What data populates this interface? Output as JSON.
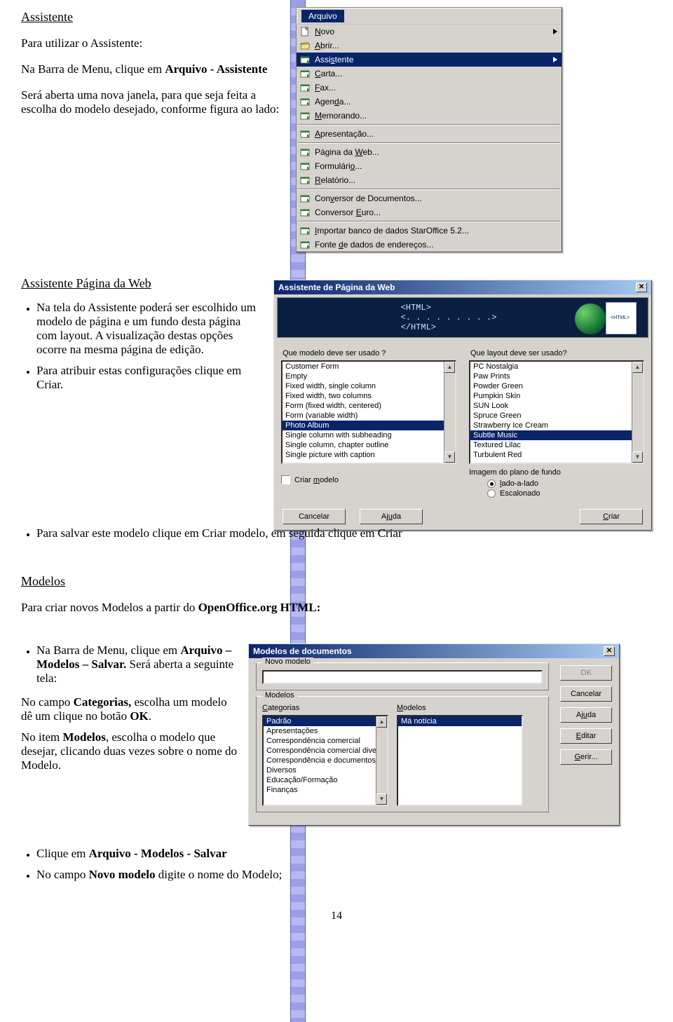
{
  "sec1": {
    "title": "Assistente",
    "p1a": "Para utilizar o Assistente:",
    "p1b_a": "Na Barra de Menu, clique em ",
    "p1b_b": "Arquivo - Assistente",
    "p1c": "Será aberta uma nova janela, para que seja feita a escolha do modelo desejado, conforme figura ao lado:"
  },
  "menu": {
    "title_label": "Arquivo",
    "items": [
      {
        "icon": "doc",
        "labelA": "N",
        "labelB": "ovo",
        "sub": true
      },
      {
        "icon": "open",
        "labelA": "A",
        "labelB": "brir..."
      },
      {
        "icon": "asst",
        "labelA": "Assi",
        "labelB": "s",
        "labelC": "tente",
        "sub": true,
        "selected": true,
        "under_mid": true
      },
      {
        "icon": "card",
        "labelA": "C",
        "labelB": "arta..."
      },
      {
        "icon": "card",
        "labelA": "F",
        "labelB": "ax..."
      },
      {
        "icon": "card",
        "labelA": "Agen",
        "labelB": "d",
        "labelC": "a...",
        "under_mid": true
      },
      {
        "icon": "card",
        "labelA": "M",
        "labelB": "emorando..."
      },
      {
        "divider": true
      },
      {
        "icon": "card",
        "labelA": "A",
        "labelB": "presentação..."
      },
      {
        "divider": true
      },
      {
        "icon": "card",
        "labelA": "Página da ",
        "labelB": "W",
        "labelC": "eb...",
        "under_mid": true
      },
      {
        "icon": "card",
        "labelA": "Formulári",
        "labelB": "o",
        "labelC": "...",
        "under_mid": true
      },
      {
        "icon": "card",
        "labelA": "R",
        "labelB": "elatório..."
      },
      {
        "divider": true
      },
      {
        "icon": "card",
        "labelA": "Con",
        "labelB": "v",
        "labelC": "ersor de Documentos...",
        "under_mid": true
      },
      {
        "icon": "card",
        "labelA": "Conversor ",
        "labelB": "E",
        "labelC": "uro...",
        "under_mid": true
      },
      {
        "divider": true
      },
      {
        "icon": "card",
        "labelA": "I",
        "labelB": "mportar banco de dados StarOffice 5.2..."
      },
      {
        "icon": "card",
        "labelA": "Fonte ",
        "labelB": "d",
        "labelC": "e dados de endereços...",
        "under_mid": true
      }
    ]
  },
  "sec2": {
    "title": "Assistente Página da Web",
    "b1": "Na tela do Assistente poderá ser escolhido um modelo de página e um fundo desta página com layout. A visualização destas opções ocorre na mesma página de edição.",
    "b2": " Para atribuir estas configurações clique em Criar.",
    "b3": "Para salvar este modelo clique em Criar modelo, em seguida clique em Criar"
  },
  "wizard": {
    "title": "Assistente de Página da Web",
    "banner": {
      "l1": "<HTML>",
      "l2": "<. . . . . . . . .>",
      "l3": "</HTML>"
    },
    "q1": "Que modelo deve ser usado ?",
    "q2": "Que layout deve ser usado?",
    "list1": [
      "Customer Form",
      "Empty",
      "Fixed width, single column",
      "Fixed width, two columns",
      "Form (fixed width, centered)",
      "Form (variable width)",
      "Photo Album",
      "Single column with subheading",
      "Single column, chapter outline",
      "Single picture with caption"
    ],
    "list1_selected": 6,
    "list2": [
      "PC Nostalgia",
      "Paw Prints",
      "Powder Green",
      "Pumpkin Skin",
      "SUN Look",
      "Spruce Green",
      "Strawberry Ice Cream",
      "Subtle Music",
      "Textured Lilac",
      "Turbulent Red"
    ],
    "list2_selected": 7,
    "check_label": "Criar modelo (underline m)",
    "check_txt_a": "Criar ",
    "check_txt_u": "m",
    "check_txt_b": "odelo",
    "bg_title": "Imagem do plano de fundo",
    "r1_a": "l",
    "r1_b": "ado-a-lado",
    "r2_b": "Escalonado",
    "btn_cancel": "Cancelar",
    "btn_help": "Ajuda",
    "btn_create": "Criar",
    "btn_create_u": "C",
    "btn_create_b": "riar"
  },
  "sec3": {
    "title": "Modelos",
    "p_a": "Para criar novos Modelos a partir do ",
    "p_b": "OpenOffice.org HTML:"
  },
  "sec3b": {
    "b1_a": "Na Barra de Menu, clique em ",
    "b1_b": "Arquivo – Modelos – Salvar.",
    "b1_c": " Será aberta a seguinte tela:",
    "p2_a": "No campo ",
    "p2_b": "Categorias,",
    "p2_c": " escolha um modelo dê um clique no botão ",
    "p2_d": "OK",
    "p2_e": ".",
    "p3_a": "No item ",
    "p3_b": "Modelos",
    "p3_c": ", escolha o modelo que desejar, clicando duas vezes sobre o nome do Modelo.",
    "b2_a": "Clique em ",
    "b2_b": "Arquivo - Modelos - Salvar",
    "b3_a": "No campo  ",
    "b3_b": "Novo modelo",
    "b3_c": " digite o nome do Modelo;"
  },
  "templates": {
    "title": "Modelos de documentos",
    "grp1": "Novo modelo",
    "grp2": "Modelos",
    "lbl_cat_u": "C",
    "lbl_cat_b": "ategorias",
    "lbl_mod_u": "M",
    "lbl_mod_b": "odelos",
    "cats": [
      "Padrão",
      "Apresentações",
      "Correspondência comercial",
      "Correspondência comercial diversa",
      "Correspondência e documentos partic",
      "Diversos",
      "Educação/Formação",
      "Finanças"
    ],
    "cats_selected": 0,
    "mods": [
      "Má notícia"
    ],
    "mods_selected": 0,
    "btns": {
      "ok": "OK",
      "cancel": "Cancelar",
      "help": "Ajuda",
      "edit": "Editar",
      "manage": "Gerir..."
    },
    "edit_u": "E",
    "edit_b": "ditar",
    "manage_u": "G",
    "manage_b": "erir...",
    "help_b": "Aj",
    "help_u": "u",
    "help_c": "da"
  },
  "pagenum": "14"
}
